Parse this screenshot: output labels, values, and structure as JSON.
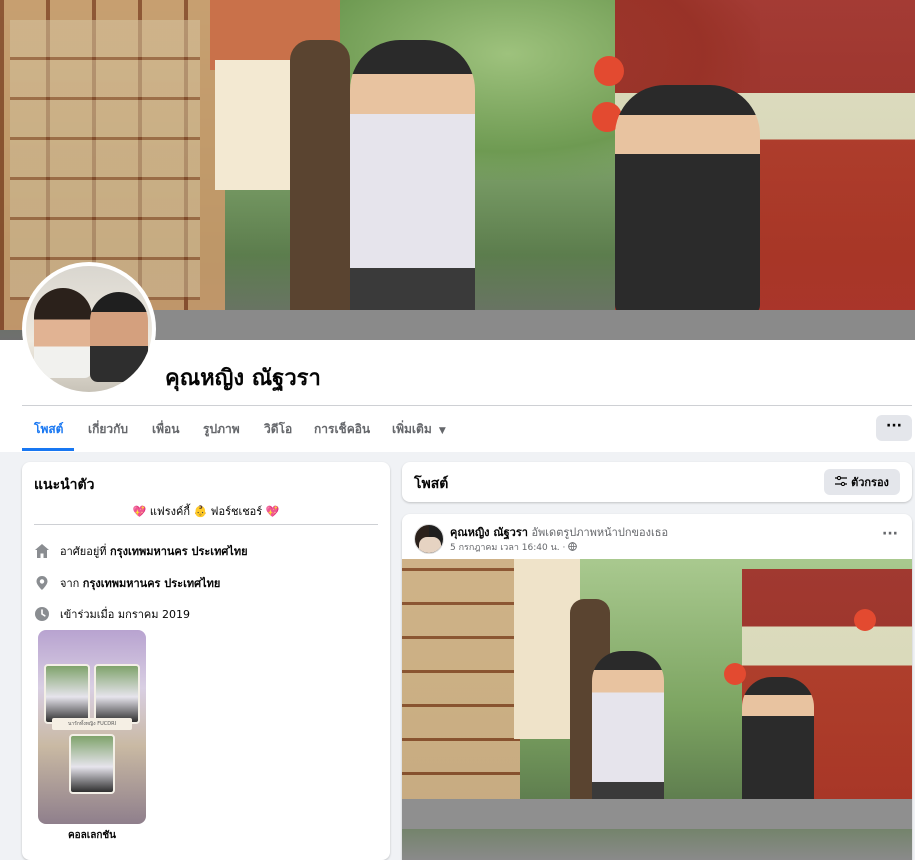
{
  "profile": {
    "name": "คุณหญิง ณัฐวรา"
  },
  "tabs": [
    {
      "label": "โพสต์",
      "active": true
    },
    {
      "label": "เกี่ยวกับ",
      "active": false
    },
    {
      "label": "เพื่อน",
      "active": false
    },
    {
      "label": "รูปภาพ",
      "active": false
    },
    {
      "label": "วิดีโอ",
      "active": false
    },
    {
      "label": "การเช็คอิน",
      "active": false
    },
    {
      "label": "เพิ่มเติม",
      "active": false
    }
  ],
  "more_menu_label": "···",
  "intro": {
    "title": "แนะนำตัว",
    "bio_left_emoji": "💖",
    "bio": "แฟรงค์กี้ 👶 ฟอร์ชเชอร์",
    "bio_right_emoji": "💖",
    "lives_prefix": "อาศัยอยู่ที่",
    "lives_city": "กรุงเทพมหานคร ประเทศไทย",
    "from_prefix": "จาก",
    "from_city": "กรุงเทพมหานคร ประเทศไทย",
    "joined": "เข้าร่วมเมื่อ มกราคม 2019",
    "collection_label": "คอลเลกชัน",
    "collection_banner": "นารักทั้งหญิง FUCDRI"
  },
  "posts_header": {
    "title": "โพสต์",
    "filter_label": "ตัวกรอง"
  },
  "post": {
    "author": "คุณหญิง ณัฐวรา",
    "action": "อัพเดตรูปภาพหน้าปกของเธอ",
    "meta": "5 กรกฎาคม เวลา 16:40 น. ·",
    "options": "···"
  },
  "colors": {
    "accent": "#1877f2",
    "background": "#f0f2f5",
    "heart": "#e0245e"
  },
  "icons": {
    "home": "home-icon",
    "location": "location-pin-icon",
    "clock": "clock-icon",
    "filter": "filter-sliders-icon",
    "globe": "globe-icon",
    "caret": "caret-down-icon"
  }
}
